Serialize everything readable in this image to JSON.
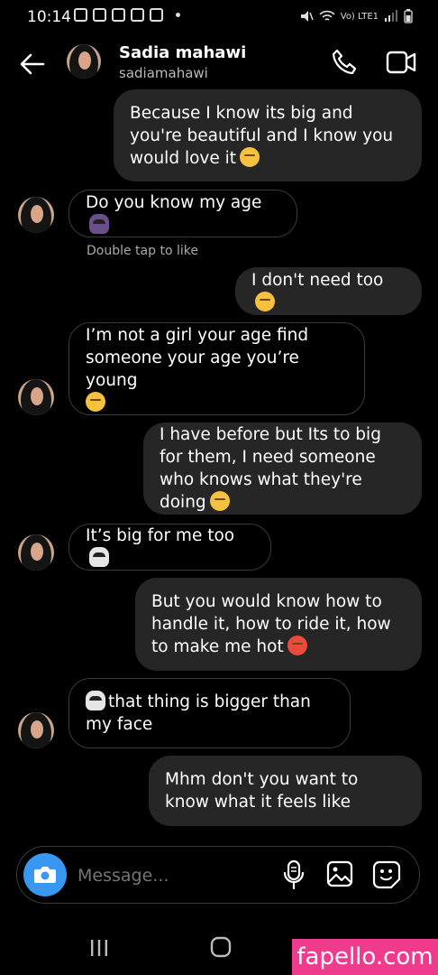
{
  "status_bar": {
    "time": "10:14",
    "network": "Vo) LTE1"
  },
  "header": {
    "name": "Sadia mahawi",
    "username": "sadiamahawi"
  },
  "messages": [
    {
      "side": "out",
      "text": "Because I know its big and you're beautiful and I know you would love it"
    },
    {
      "side": "in",
      "text": "Do you know my age"
    },
    {
      "side": "out",
      "text": "I don't need too"
    },
    {
      "side": "in",
      "text": "I’m not a girl your age find someone your age you’re young"
    },
    {
      "side": "out",
      "text": "I have before but Its to big for them, I need someone who knows what they're doing"
    },
    {
      "side": "in",
      "text": "It’s big for me too"
    },
    {
      "side": "out",
      "text": "But you would know how to handle it, how to ride it, how to make me hot"
    },
    {
      "side": "in",
      "text": "that thing is bigger than my face"
    },
    {
      "side": "out",
      "text": "Mhm don't you want to know what it feels like"
    }
  ],
  "like_hint": "Double tap to like",
  "composer": {
    "placeholder": "Message..."
  },
  "watermark": "fapello.com",
  "colors": {
    "accent": "#3897f0",
    "outgoing_bubble": "#262626",
    "watermark_bg": "#ef3b8d"
  },
  "icons": [
    "back-arrow-icon",
    "phone-icon",
    "video-icon",
    "camera-icon",
    "mic-icon",
    "gallery-icon",
    "sticker-icon"
  ]
}
